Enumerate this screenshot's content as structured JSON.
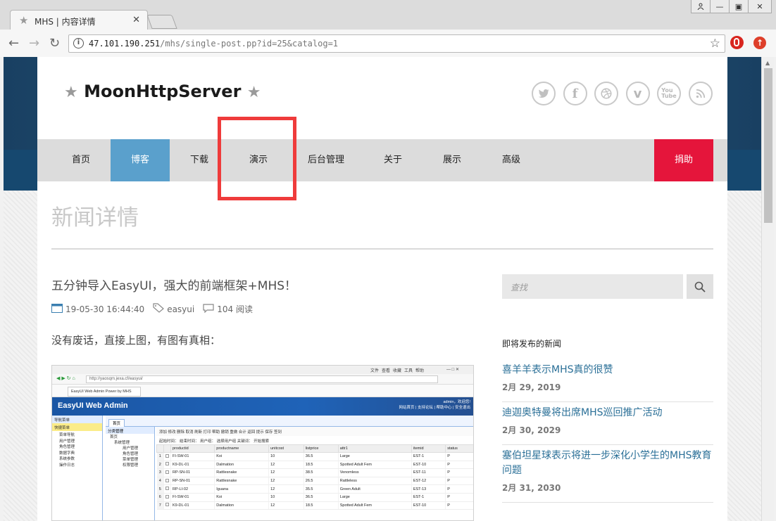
{
  "browser": {
    "tab_title": "MHS | 内容详情",
    "url_host": "47.101.190.251",
    "url_path": "/mhs/single-post.pp?id=25&catalog=1"
  },
  "site": {
    "title": "MoonHttpServer",
    "socials": [
      "twitter-icon",
      "facebook-icon",
      "dribbble-icon",
      "vimeo-icon",
      "youtube-icon",
      "rss-icon"
    ]
  },
  "nav": {
    "items": [
      "首页",
      "博客",
      "下载",
      "演示",
      "后台管理",
      "关于",
      "展示",
      "高级"
    ],
    "active_index": 1,
    "donate": "捐助"
  },
  "page": {
    "heading": "新闻详情"
  },
  "post": {
    "title": "五分钟导入EasyUI，强大的前端框架+MHS！",
    "date": "19-05-30 16:44:40",
    "tag": "easyui",
    "reads": "104 阅读",
    "intro": "没有废话，直接上图，有图有真相："
  },
  "embedded": {
    "top_menu": [
      "文件",
      "查看",
      "收藏",
      "工具",
      "帮助"
    ],
    "address": "http://yaosqm.jexa.cf/easyui/",
    "tab_title": "EasyUI Web Admin Power by MHS",
    "brand": "EasyUI Web Admin",
    "user_line1": "admin，欢迎您!",
    "user_line2": "网站首页 | 支持论坛 | 帮助中心 | 安全退出",
    "nav_header": "导航菜单",
    "quick_menu": "快捷菜单",
    "left_items": [
      "菜单导航",
      "用户管理",
      "角色管理",
      "数据字典",
      "系统参数",
      "操作日志"
    ],
    "main_tab": "首页",
    "tree_header": "分类管理",
    "tree_nodes": [
      "首页",
      "系统管理",
      "用户管理",
      "角色管理",
      "菜单管理",
      "权限管理"
    ],
    "toolbar": "添加  修改  删除  取消  刷新  打印  帮助  撤销  重做  合计  返回  提示  保存  签到",
    "filter": "起始时间：             结束时间：             用户组：  选择用户组        关键词：               开始搜索",
    "columns": [
      "productid",
      "productname",
      "unitcost",
      "listprice",
      "attr1",
      "itemid",
      "status"
    ],
    "rows": [
      [
        "1",
        "FI-SW-01",
        "Koi",
        "10",
        "36.5",
        "Large",
        "EST-1",
        "P"
      ],
      [
        "2",
        "K9-DL-01",
        "Dalmation",
        "12",
        "18.5",
        "Spotted Adult Fem",
        "EST-10",
        "P"
      ],
      [
        "3",
        "RP-SN-01",
        "Rattlesnake",
        "12",
        "38.5",
        "Venomless",
        "EST-11",
        "P"
      ],
      [
        "4",
        "RP-SN-01",
        "Rattlesnake",
        "12",
        "26.5",
        "Rattleless",
        "EST-12",
        "P"
      ],
      [
        "5",
        "RP-LI-02",
        "Iguana",
        "12",
        "35.5",
        "Green Adult",
        "EST-13",
        "P"
      ],
      [
        "6",
        "FI-SW-01",
        "Koi",
        "10",
        "36.5",
        "Large",
        "EST-1",
        "P"
      ],
      [
        "7",
        "K9-DL-01",
        "Dalmation",
        "12",
        "18.5",
        "Spotted Adult Fem",
        "EST-10",
        "P"
      ]
    ]
  },
  "sidebar": {
    "search_placeholder": "查找",
    "widget_title": "即将发布的新闻",
    "news": [
      {
        "title": "喜羊羊表示MHS真的很赞",
        "date": "2月 29, 2019"
      },
      {
        "title": "迪迦奥特曼将出席MHS巡回推广活动",
        "date": "2月 30, 2029"
      },
      {
        "title": "塞伯坦星球表示将进一步深化小学生的MHS教育问题",
        "date": "2月 31, 2030"
      }
    ]
  },
  "colors": {
    "nav_active": "#5aa0cc",
    "donate": "#e5153b",
    "highlight_box": "#ef3b3b",
    "link": "#2a6f97"
  }
}
